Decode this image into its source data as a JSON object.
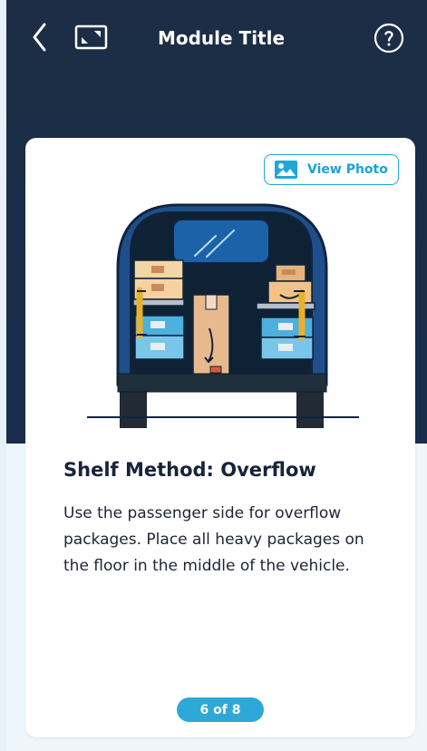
{
  "header": {
    "title": "Module Title",
    "back_icon": "chevron-left-icon",
    "expand_icon": "fullscreen-icon",
    "help_icon": "help-circle-icon"
  },
  "card": {
    "view_photo_label": "View Photo",
    "photo_icon": "image-icon",
    "title": "Shelf Method: Overflow",
    "body_lines": [
      "Use the passenger side for overflow",
      "packages. Place all heavy packages on",
      "the floor in the middle of the vehicle."
    ],
    "progress": "6 of 8"
  },
  "colors": {
    "header_bg": "#1D2D45",
    "accent": "#1AA3D7",
    "card_bg": "#FFFFFF",
    "text": "#17233B"
  },
  "illustration": {
    "icon": "delivery-van-illustration"
  }
}
